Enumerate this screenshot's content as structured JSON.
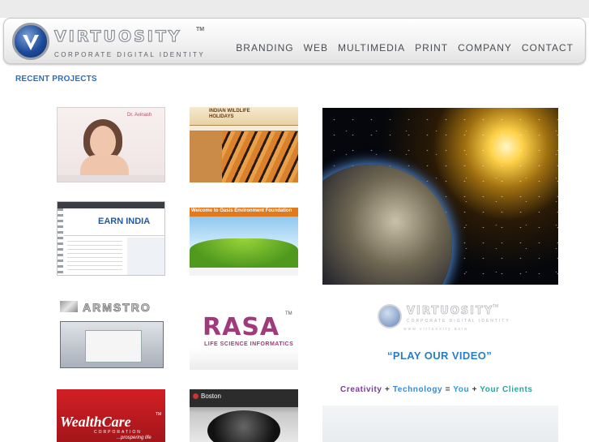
{
  "header": {
    "brand": "VIRTUOSITY",
    "trademark": "TM",
    "tagline": "CORPORATE DIGITAL IDENTITY",
    "nav": [
      {
        "label": "BRANDING"
      },
      {
        "label": "WEB"
      },
      {
        "label": "MULTIMEDIA"
      },
      {
        "label": "PRINT"
      },
      {
        "label": "COMPANY"
      },
      {
        "label": "CONTACT"
      }
    ]
  },
  "section_title": "RECENT PROJECTS",
  "thumbnails": {
    "t1": {
      "name": "Dr. Avinash"
    },
    "t2": {
      "name": "INDIAN WILDLIFE HOLIDAYS"
    },
    "t3": {
      "name": "EARN INDIA"
    },
    "t4": {
      "name": "Welcome to Oasis Environment Foundation"
    },
    "t5": {
      "name": "ARMSTRO"
    },
    "t6": {
      "name": "RASA",
      "tm": "TM",
      "sub": "LIFE SCIENCE INFORMATICS"
    },
    "t7": {
      "name": "WealthCare",
      "tm": "TM",
      "corp": "CORPORATION",
      "tag": "...prospering life"
    },
    "t8": {
      "name": "Boston"
    }
  },
  "video": {
    "brand": "VIRTUOSITY",
    "trademark": "TM",
    "tagline": "CORPORATE DIGITAL IDENTITY",
    "url": "www.virtuosity.asia",
    "play_label": "“PLAY OUR VIDEO”",
    "equation": {
      "creativity": "Creativity",
      "plus1": "+",
      "technology": "Technology",
      "equals": "=",
      "you": "You",
      "plus2": "+",
      "clients": "Your Clients"
    }
  },
  "colors": {
    "accent_blue": "#2f6db8",
    "nav_text": "#4a4d52",
    "rasa_purple": "#a13a7a",
    "wealthcare_red": "#d21f24"
  }
}
